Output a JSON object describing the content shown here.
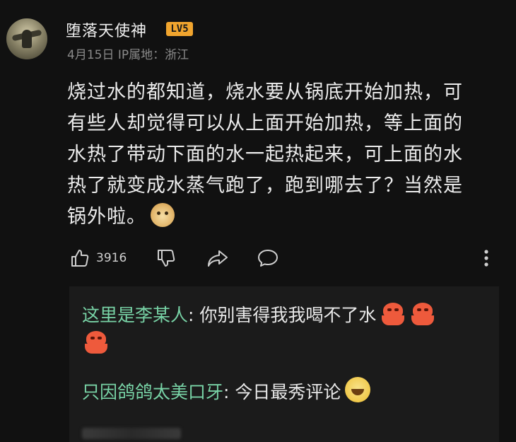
{
  "post": {
    "author": "堕落天使神",
    "level": "LV5",
    "meta": "4月15日 IP属地：浙江",
    "body_lines": [
      "烧过水的都知道，烧水要从锅底开始加热，可",
      "有些人却觉得可以从上面开始加热，等上面的",
      "水热了带动下面的水一起热起来，可上面的水",
      "热了就变成水蒸气跑了，跑到哪去了？当然是",
      "锅外啦。"
    ],
    "emoji": "doge-emoji"
  },
  "actions": {
    "like_count": "3916",
    "icons": [
      "thumb-up-icon",
      "thumb-down-icon",
      "share-icon",
      "comment-icon",
      "more-vertical-icon"
    ]
  },
  "replies": [
    {
      "author": "这里是李某人",
      "separator": ": ",
      "text": "你别害得我我喝不了水",
      "emojis": [
        "angry-octopus-emoji",
        "angry-octopus-emoji",
        "angry-octopus-emoji"
      ]
    },
    {
      "author": "只因鸽鸽太美口牙",
      "separator": ": ",
      "text": "今日最秀评论",
      "emojis": [
        "laughing-emoji"
      ]
    }
  ],
  "colors": {
    "background": "#111111",
    "reply_background": "#1b1b1b",
    "reply_author": "#78d3a6",
    "level_badge": "#f1a52e"
  }
}
